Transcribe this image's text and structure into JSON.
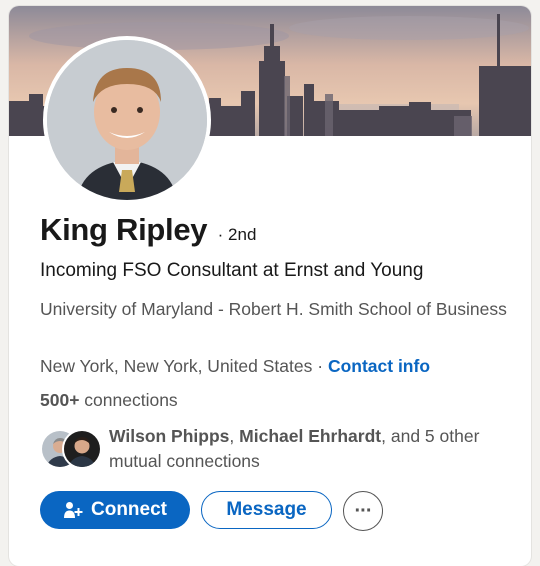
{
  "profile": {
    "name": "King Ripley",
    "degree": "· 2nd",
    "headline": "Incoming FSO Consultant at Ernst and Young",
    "education": "University of Maryland - Robert H. Smith School of Business",
    "location": "New York, New York, United States",
    "location_sep": " · ",
    "contact_label": "Contact info",
    "connections_count": "500+",
    "connections_label": " connections"
  },
  "mutual": {
    "name1": "Wilson Phipps",
    "sep": ", ",
    "name2": "Michael Ehrhardt",
    "suffix": ", and 5 other mutual connections"
  },
  "actions": {
    "connect_label": "Connect",
    "message_label": "Message",
    "more_label": "···"
  },
  "icons": {
    "connect": "person-plus-icon",
    "more": "ellipsis-icon"
  },
  "colors": {
    "accent": "#0a66c2",
    "text_primary": "#191919",
    "text_secondary": "#555555",
    "page_bg": "#f3f2ef"
  }
}
